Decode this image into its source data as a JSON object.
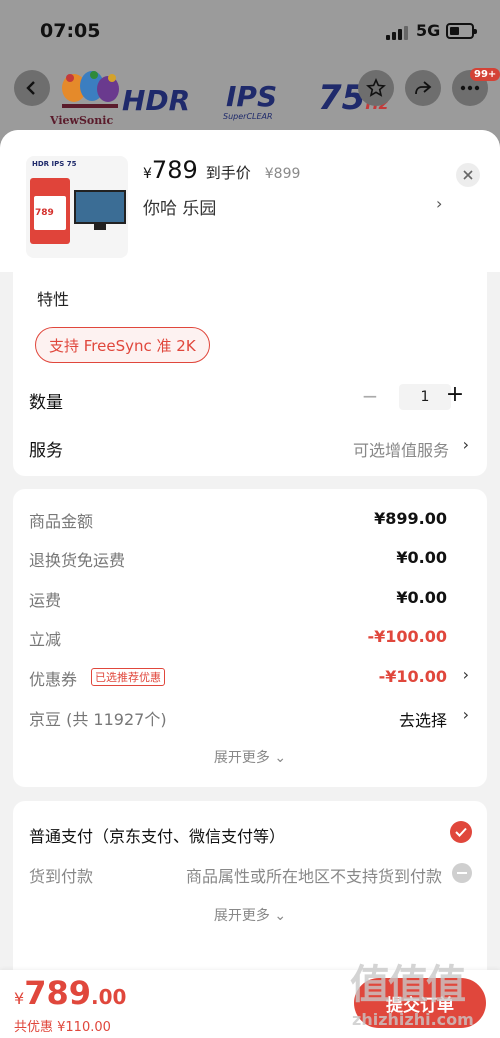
{
  "status_bar": {
    "time": "07:05",
    "network": "5G"
  },
  "banner": {
    "brand": "ViewSonic",
    "hdr": "HDR",
    "ips": "IPS",
    "ips_sub": "SuperCLEAR",
    "hz_number": "75",
    "hz_unit": "Hz"
  },
  "nav": {
    "badge": "99+"
  },
  "product": {
    "thumb_price": "789",
    "price_symbol": "¥",
    "price": "789",
    "price_label": "到手价",
    "original_price": "¥899",
    "sku": "你哈  乐园",
    "sku_arrow": "›"
  },
  "spec": {
    "title": "特性",
    "option": "支持 FreeSync 准 2K"
  },
  "quantity": {
    "label": "数量",
    "minus": "−",
    "value": "1",
    "plus": "+"
  },
  "service": {
    "label": "服务",
    "value": "可选增值服务",
    "arrow": "›"
  },
  "fees": {
    "rows": [
      {
        "label": "商品金额",
        "value": "¥899.00"
      },
      {
        "label": "退换货免运费",
        "value": "¥0.00"
      },
      {
        "label": "运费",
        "value": "¥0.00"
      },
      {
        "label": "立减",
        "value": "-¥100.00"
      },
      {
        "label": "优惠券",
        "tag": "已选推荐优惠",
        "value": "-¥10.00"
      },
      {
        "label": "京豆 (共 11927个)",
        "value": "去选择"
      }
    ],
    "expand": "展开更多 ⌄"
  },
  "payment": {
    "normal": "普通支付（京东支付、微信支付等）",
    "cod_label": "货到付款",
    "cod_note": "商品属性或所在地区不支持货到付款",
    "expand": "展开更多 ⌄"
  },
  "footer": {
    "total_symbol": "¥",
    "total_int": "789",
    "total_dec": ".00",
    "discount": "共优惠 ¥110.00",
    "submit": "提交订单"
  },
  "watermark": {
    "chars": "值值值",
    "url": "zhizhizhi.com"
  },
  "colors": {
    "accent": "#e0473c",
    "sheet_bg": "#f2f2f2",
    "overlay": "#8a8a8a"
  }
}
